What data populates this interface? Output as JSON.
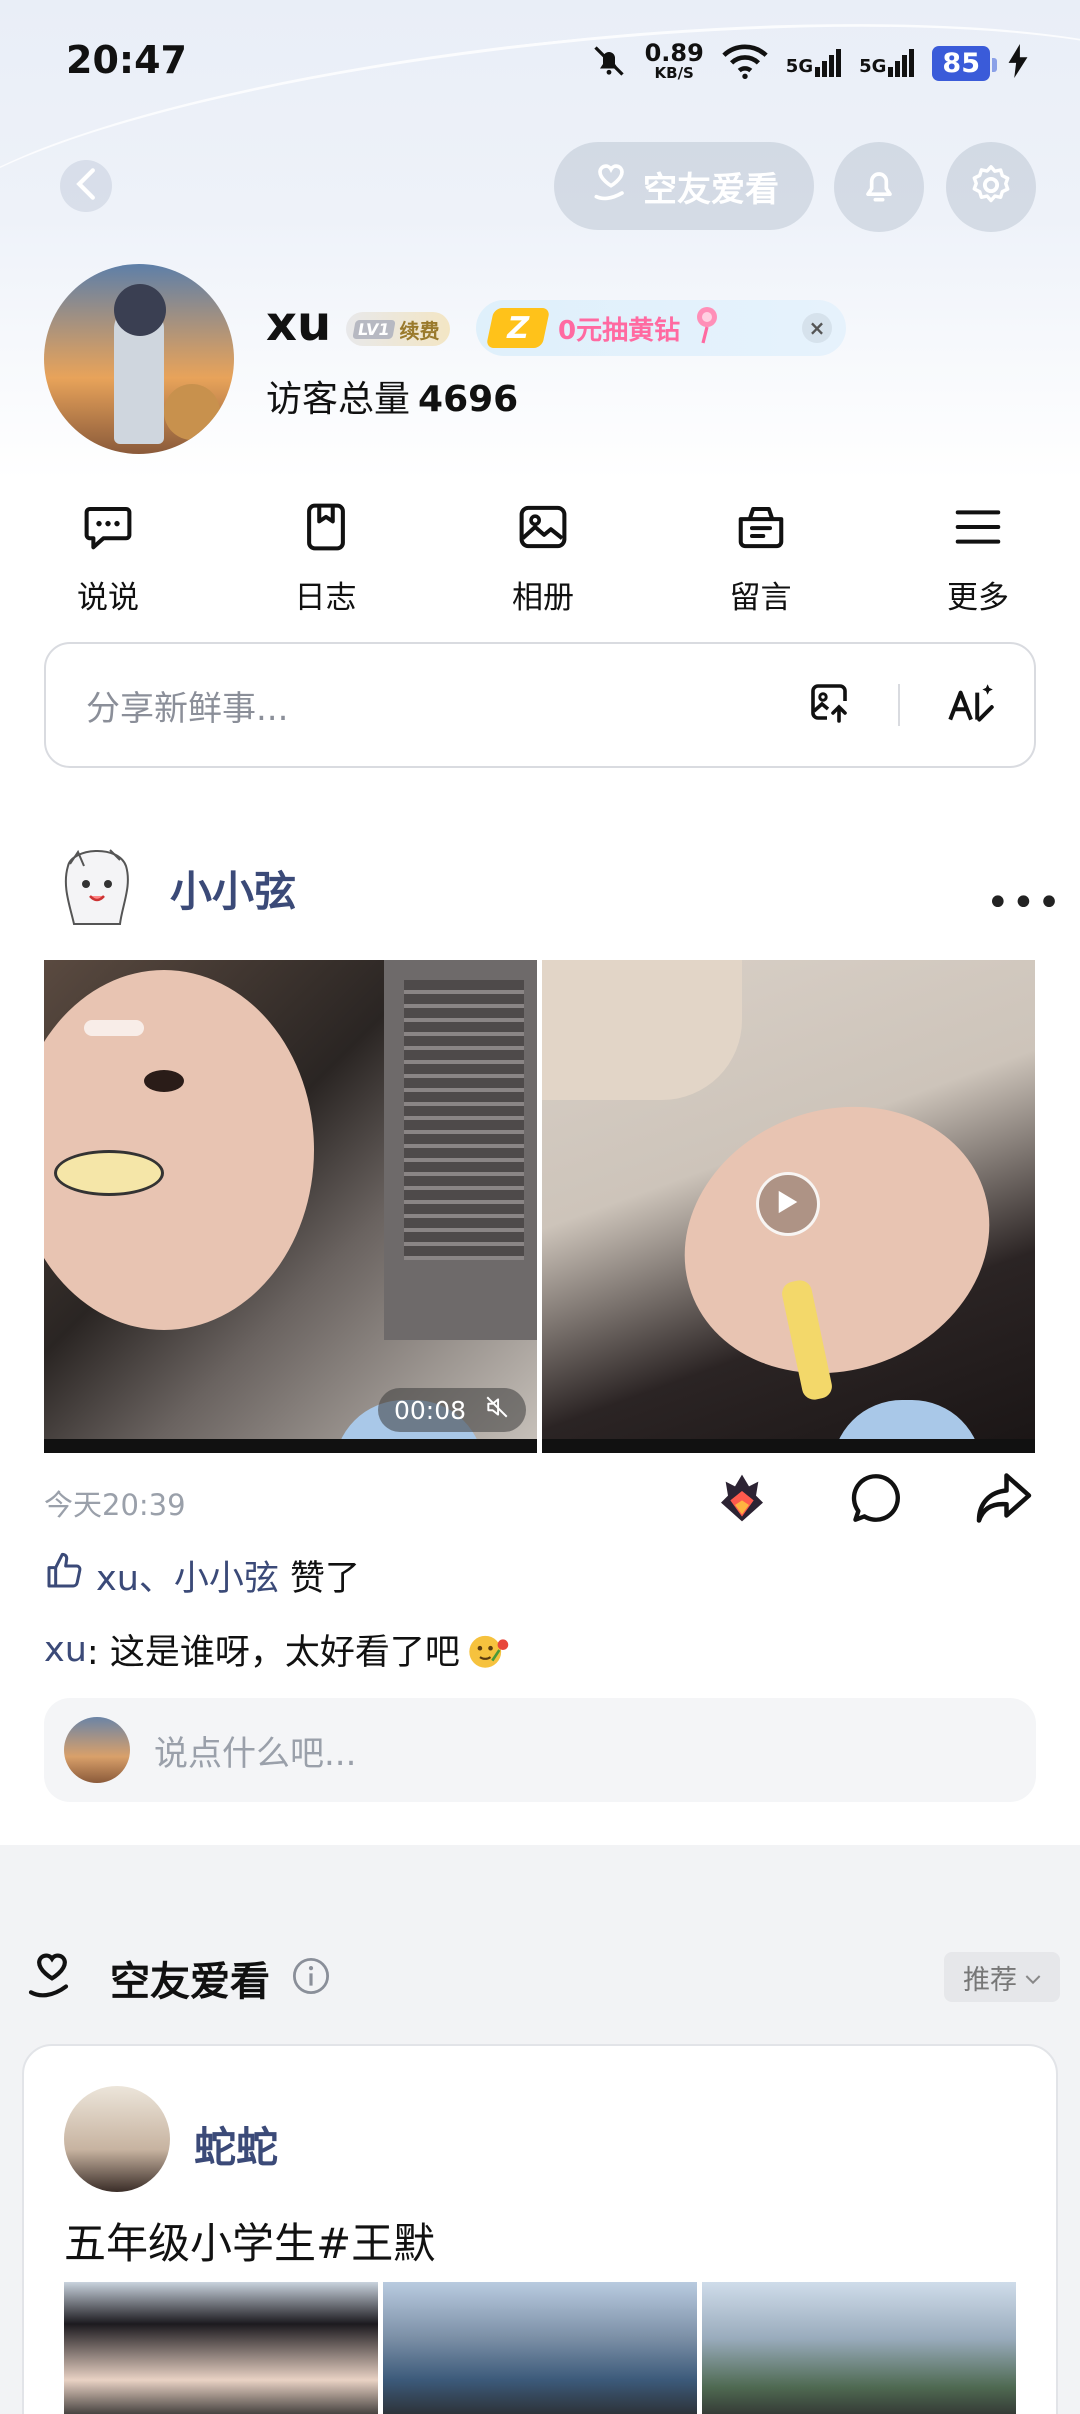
{
  "status_bar": {
    "time": "20:47",
    "net_speed": "0.89",
    "net_unit": "KB/S",
    "signal1": "5G",
    "signal2": "5G",
    "battery": "85"
  },
  "header": {
    "kongyou_button": "空友爱看"
  },
  "profile": {
    "username": "xu",
    "level": "LV1",
    "renew": "续费",
    "promo_text": "0元抽黄钻",
    "promo_logo": "Z",
    "promo_close": "×",
    "visits_label": "访客总量",
    "visits_count": "4696"
  },
  "quick_nav": [
    {
      "label": "说说",
      "icon": "chat-bubble-icon"
    },
    {
      "label": "日志",
      "icon": "bookmark-icon"
    },
    {
      "label": "相册",
      "icon": "image-icon"
    },
    {
      "label": "留言",
      "icon": "message-bag-icon"
    },
    {
      "label": "更多",
      "icon": "menu-icon"
    }
  ],
  "share": {
    "placeholder": "分享新鲜事..."
  },
  "post": {
    "author": "小小弦",
    "more": "•••",
    "video_duration": "00:08",
    "time": "今天20:39",
    "likes_names": "xu、小小弦",
    "likes_suffix": "赞了",
    "comment_author": "xu",
    "comment_text": ": 这是谁呀，太好看了吧",
    "reply_placeholder": "说点什么吧..."
  },
  "kongyou_section": {
    "title": "空友爱看",
    "filter": "推荐",
    "card": {
      "author": "蛇蛇",
      "text": "五年级小学生#王默"
    }
  },
  "colors": {
    "link_blue": "#3b4a78",
    "battery_blue": "#3a5bd9",
    "promo_pink": "#ff6aa1"
  }
}
